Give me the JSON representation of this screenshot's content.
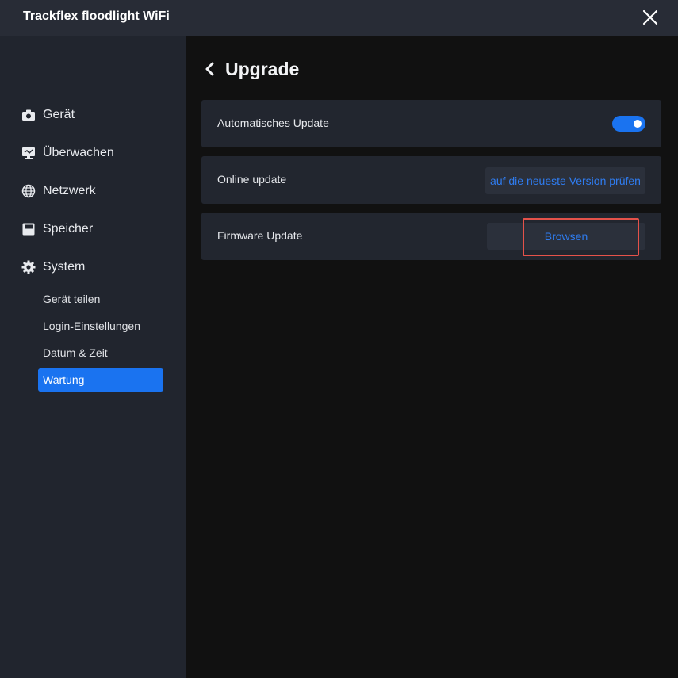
{
  "window": {
    "title": "Trackflex floodlight WiFi",
    "close_icon": "close-icon"
  },
  "sidebar": {
    "items": [
      {
        "label": "Gerät",
        "icon": "camera-icon"
      },
      {
        "label": "Überwachen",
        "icon": "monitor-icon"
      },
      {
        "label": "Netzwerk",
        "icon": "globe-icon"
      },
      {
        "label": "Speicher",
        "icon": "storage-icon"
      },
      {
        "label": "System",
        "icon": "gear-icon"
      }
    ],
    "sub_items": [
      {
        "label": "Gerät teilen",
        "active": false
      },
      {
        "label": "Login-Einstellungen",
        "active": false
      },
      {
        "label": "Datum & Zeit",
        "active": false
      },
      {
        "label": "Wartung",
        "active": true
      }
    ]
  },
  "main": {
    "title": "Upgrade",
    "back_icon": "chevron-left-icon",
    "rows": {
      "auto_update": {
        "label": "Automatisches Update",
        "enabled": true
      },
      "online_update": {
        "label": "Online update",
        "action": "auf die neueste Version prüfen"
      },
      "firmware_update": {
        "label": "Firmware Update",
        "action": "Browsen"
      }
    }
  },
  "colors": {
    "accent": "#1a73f0",
    "link": "#2f7cf0",
    "highlight": "#e5524a",
    "sidebar_bg": "#21252e",
    "titlebar_bg": "#282c36"
  }
}
